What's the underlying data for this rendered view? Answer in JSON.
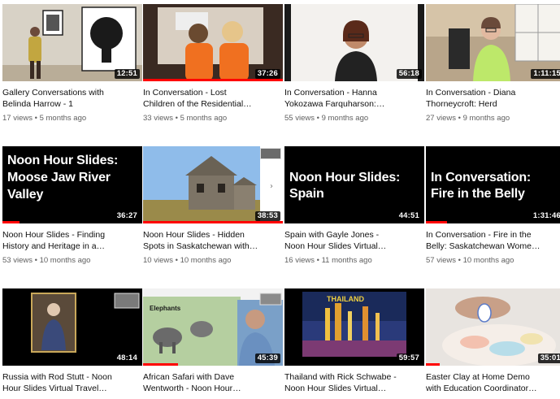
{
  "videos": [
    {
      "title_l1": "Gallery Conversations with",
      "title_l2": "Belinda Harrow - 1",
      "views": "17 views",
      "age": "5 months ago",
      "duration": "12:51",
      "progress": 0.0
    },
    {
      "title_l1": "In Conversation - Lost",
      "title_l2": "Children of the Residential…",
      "views": "33 views",
      "age": "5 months ago",
      "duration": "37:26",
      "progress": 1.0
    },
    {
      "title_l1": "In Conversation - Hanna",
      "title_l2": "Yokozawa Farquharson:…",
      "views": "55 views",
      "age": "9 months ago",
      "duration": "56:18",
      "progress": 0.0
    },
    {
      "title_l1": "In Conversation - Diana",
      "title_l2": "Thorneycroft: Herd",
      "views": "27 views",
      "age": "9 months ago",
      "duration": "1:11:15",
      "progress": 0.0
    },
    {
      "title_l1": "Noon Hour Slides - Finding",
      "title_l2": "History and Heritage in a…",
      "views": "53 views",
      "age": "10 months ago",
      "duration": "36:27",
      "progress": 0.12,
      "slide_line1": "Noon Hour Slides:",
      "slide_line2": "Moose Jaw River",
      "slide_line3": "Valley"
    },
    {
      "title_l1": "Noon Hour Slides - Hidden",
      "title_l2": "Spots in Saskatchewan with…",
      "views": "10 views",
      "age": "10 months ago",
      "duration": "38:53",
      "progress": 1.0
    },
    {
      "title_l1": "Spain with Gayle Jones -",
      "title_l2": "Noon Hour Slides Virtual…",
      "views": "16 views",
      "age": "11 months ago",
      "duration": "44:51",
      "progress": 0.0,
      "slide_line1": "Noon Hour Slides:",
      "slide_line2": "Spain"
    },
    {
      "title_l1": "In Conversation - Fire in the",
      "title_l2": "Belly: Saskatchewan Wome…",
      "views": "57 views",
      "age": "10 months ago",
      "duration": "1:31:46",
      "progress": 0.15,
      "slide_line1": "In Conversation:",
      "slide_line2": "Fire in the Belly"
    },
    {
      "title_l1": "Russia with Rod Stutt - Noon",
      "title_l2": "Hour Slides Virtual Travel…",
      "views": "",
      "age": "",
      "duration": "48:14",
      "progress": 0.0
    },
    {
      "title_l1": "African Safari with Dave",
      "title_l2": "Wentworth - Noon Hour…",
      "views": "",
      "age": "",
      "duration": "45:39",
      "progress": 0.25,
      "caption": "Elephants"
    },
    {
      "title_l1": "Thailand with Rick Schwabe -",
      "title_l2": "Noon Hour Slides Virtual…",
      "views": "",
      "age": "",
      "duration": "59:57",
      "progress": 0.0,
      "caption": "THAILAND"
    },
    {
      "title_l1": "Easter Clay at Home Demo",
      "title_l2": "with Education Coordinator…",
      "views": "",
      "age": "",
      "duration": "35:01",
      "progress": 0.1
    }
  ],
  "meta_separator": "•"
}
